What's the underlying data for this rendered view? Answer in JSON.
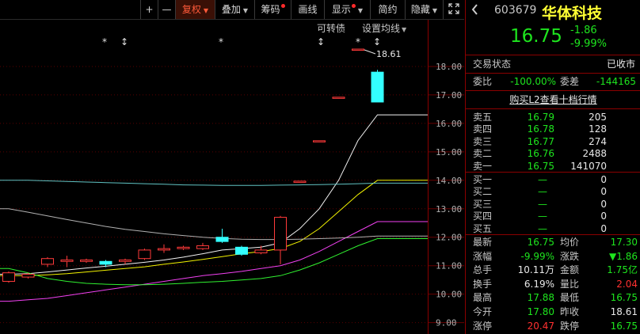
{
  "toolbar": {
    "plus": "+",
    "minus": "—",
    "fuquan": "复权",
    "diejia": "叠加",
    "chouma": "筹码",
    "huaxian": "画线",
    "xianshi": "显示",
    "jianyue": "简约",
    "yincang": "隐藏",
    "expand_icon": "expand-icon"
  },
  "sub_toolbar": {
    "convertible": "可转债",
    "ma_settings": "设置均线"
  },
  "chart_data": {
    "type": "candlestick",
    "y_ticks": [
      "18.00",
      "17.00",
      "16.00",
      "15.00",
      "14.00",
      "13.00",
      "12.00",
      "11.00",
      "10.00",
      "9.00"
    ],
    "ylim": [
      8.6,
      19.0
    ],
    "max_annotation": "18.61",
    "candles": [
      {
        "open": 10.45,
        "close": 10.75,
        "high": 10.8,
        "low": 10.4
      },
      {
        "open": 10.6,
        "close": 10.7,
        "high": 10.75,
        "low": 10.55
      },
      {
        "open": 11.05,
        "close": 11.25,
        "high": 11.3,
        "low": 10.95
      },
      {
        "open": 11.15,
        "close": 11.2,
        "high": 11.35,
        "low": 10.95
      },
      {
        "open": 11.15,
        "close": 11.2,
        "high": 11.25,
        "low": 11.1
      },
      {
        "open": 11.15,
        "close": 11.05,
        "high": 11.2,
        "low": 10.95
      },
      {
        "open": 11.15,
        "close": 11.2,
        "high": 11.25,
        "low": 11.05
      },
      {
        "open": 11.25,
        "close": 11.55,
        "high": 11.6,
        "low": 11.2
      },
      {
        "open": 11.55,
        "close": 11.6,
        "high": 11.75,
        "low": 11.45
      },
      {
        "open": 11.6,
        "close": 11.65,
        "high": 11.7,
        "low": 11.55
      },
      {
        "open": 11.6,
        "close": 11.7,
        "high": 11.8,
        "low": 11.55
      },
      {
        "open": 12.0,
        "close": 11.85,
        "high": 12.3,
        "low": 11.8
      },
      {
        "open": 11.65,
        "close": 11.4,
        "high": 11.7,
        "low": 11.35
      },
      {
        "open": 11.45,
        "close": 11.55,
        "high": 11.7,
        "low": 11.4
      },
      {
        "open": 11.55,
        "close": 12.7,
        "high": 12.75,
        "low": 11.05
      },
      {
        "open": 13.95,
        "close": 13.97,
        "high": 13.97,
        "low": 13.95
      },
      {
        "open": 15.37,
        "close": 15.39,
        "high": 15.39,
        "low": 15.37
      },
      {
        "open": 16.9,
        "close": 16.92,
        "high": 16.92,
        "low": 16.9
      },
      {
        "open": 18.6,
        "close": 18.61,
        "high": 18.61,
        "low": 18.6
      },
      {
        "open": 17.8,
        "close": 16.75,
        "high": 17.88,
        "low": 16.75
      }
    ],
    "ma_lines": [
      {
        "color": "#ffffff",
        "values": [
          10.7,
          10.72,
          10.78,
          10.85,
          10.92,
          10.98,
          11.05,
          11.12,
          11.2,
          11.3,
          11.42,
          11.55,
          11.6,
          11.65,
          11.8,
          12.3,
          13.0,
          14.0,
          15.4,
          16.3
        ]
      },
      {
        "color": "#ffff00",
        "values": [
          10.65,
          10.65,
          10.68,
          10.72,
          10.78,
          10.84,
          10.9,
          10.96,
          11.05,
          11.13,
          11.22,
          11.32,
          11.42,
          11.5,
          11.6,
          11.85,
          12.3,
          12.9,
          13.5,
          14.0
        ]
      },
      {
        "color": "#ff44ff",
        "values": [
          9.75,
          9.8,
          9.85,
          9.95,
          10.05,
          10.15,
          10.25,
          10.35,
          10.45,
          10.55,
          10.65,
          10.72,
          10.8,
          10.9,
          11.0,
          11.2,
          11.5,
          11.85,
          12.2,
          12.55
        ]
      },
      {
        "color": "#33ff33",
        "values": [
          10.9,
          10.75,
          10.55,
          10.45,
          10.38,
          10.35,
          10.33,
          10.33,
          10.35,
          10.38,
          10.42,
          10.45,
          10.5,
          10.55,
          10.65,
          10.85,
          11.1,
          11.4,
          11.7,
          11.95
        ]
      },
      {
        "color": "#66cccc",
        "values": [
          14.0,
          14.0,
          13.98,
          13.96,
          13.94,
          13.92,
          13.9,
          13.88,
          13.86,
          13.84,
          13.83,
          13.82,
          13.82,
          13.82,
          13.83,
          13.84,
          13.85,
          13.86,
          13.88,
          13.9
        ]
      },
      {
        "color": "#bbbbbb",
        "values": [
          13.0,
          12.88,
          12.75,
          12.62,
          12.5,
          12.38,
          12.28,
          12.2,
          12.12,
          12.06,
          12.0,
          11.96,
          11.93,
          11.92,
          11.92,
          11.93,
          11.95,
          11.97,
          12.0,
          12.04
        ]
      }
    ],
    "markers": [
      "*",
      "↕",
      "*",
      "↕",
      "*",
      "↕"
    ]
  },
  "quote": {
    "code": "603679",
    "name": "华体科技",
    "price": "16.75",
    "change": "-1.86",
    "change_pct": "-9.99%",
    "trade_status_label": "交易状态",
    "trade_status_value": "已收市",
    "weibi_label": "委比",
    "weibi_value": "-100.00%",
    "weicha_label": "委差",
    "weicha_value": "-144165",
    "l2_link": "购买L2查看十档行情",
    "asks": [
      {
        "label": "卖五",
        "price": "16.79",
        "volume": "205"
      },
      {
        "label": "卖四",
        "price": "16.78",
        "volume": "128"
      },
      {
        "label": "卖三",
        "price": "16.77",
        "volume": "274"
      },
      {
        "label": "卖二",
        "price": "16.76",
        "volume": "2488"
      },
      {
        "label": "卖一",
        "price": "16.75",
        "volume": "141070"
      }
    ],
    "bids": [
      {
        "label": "买一",
        "price": "—",
        "volume": "0"
      },
      {
        "label": "买二",
        "price": "—",
        "volume": "0"
      },
      {
        "label": "买三",
        "price": "—",
        "volume": "0"
      },
      {
        "label": "买四",
        "price": "—",
        "volume": "0"
      },
      {
        "label": "买五",
        "price": "—",
        "volume": "0"
      }
    ],
    "stats": [
      {
        "l1": "最新",
        "v1": "16.75",
        "c1": "green",
        "l2": "均价",
        "v2": "17.30",
        "c2": "green"
      },
      {
        "l1": "涨幅",
        "v1": "-9.99%",
        "c1": "green",
        "l2": "涨跌",
        "v2": "▼1.86",
        "c2": "green"
      },
      {
        "l1": "总手",
        "v1": "10.11万",
        "c1": "white",
        "l2": "金额",
        "v2": "1.75亿",
        "c2": "green"
      },
      {
        "l1": "换手",
        "v1": "6.19%",
        "c1": "white",
        "l2": "量比",
        "v2": "2.04",
        "c2": "red"
      },
      {
        "l1": "最高",
        "v1": "17.88",
        "c1": "green",
        "l2": "最低",
        "v2": "16.75",
        "c2": "green"
      },
      {
        "l1": "今开",
        "v1": "17.80",
        "c1": "green",
        "l2": "昨收",
        "v2": "18.61",
        "c2": "white"
      },
      {
        "l1": "涨停",
        "v1": "20.47",
        "c1": "red",
        "l2": "跌停",
        "v2": "16.75",
        "c2": "green"
      }
    ]
  }
}
